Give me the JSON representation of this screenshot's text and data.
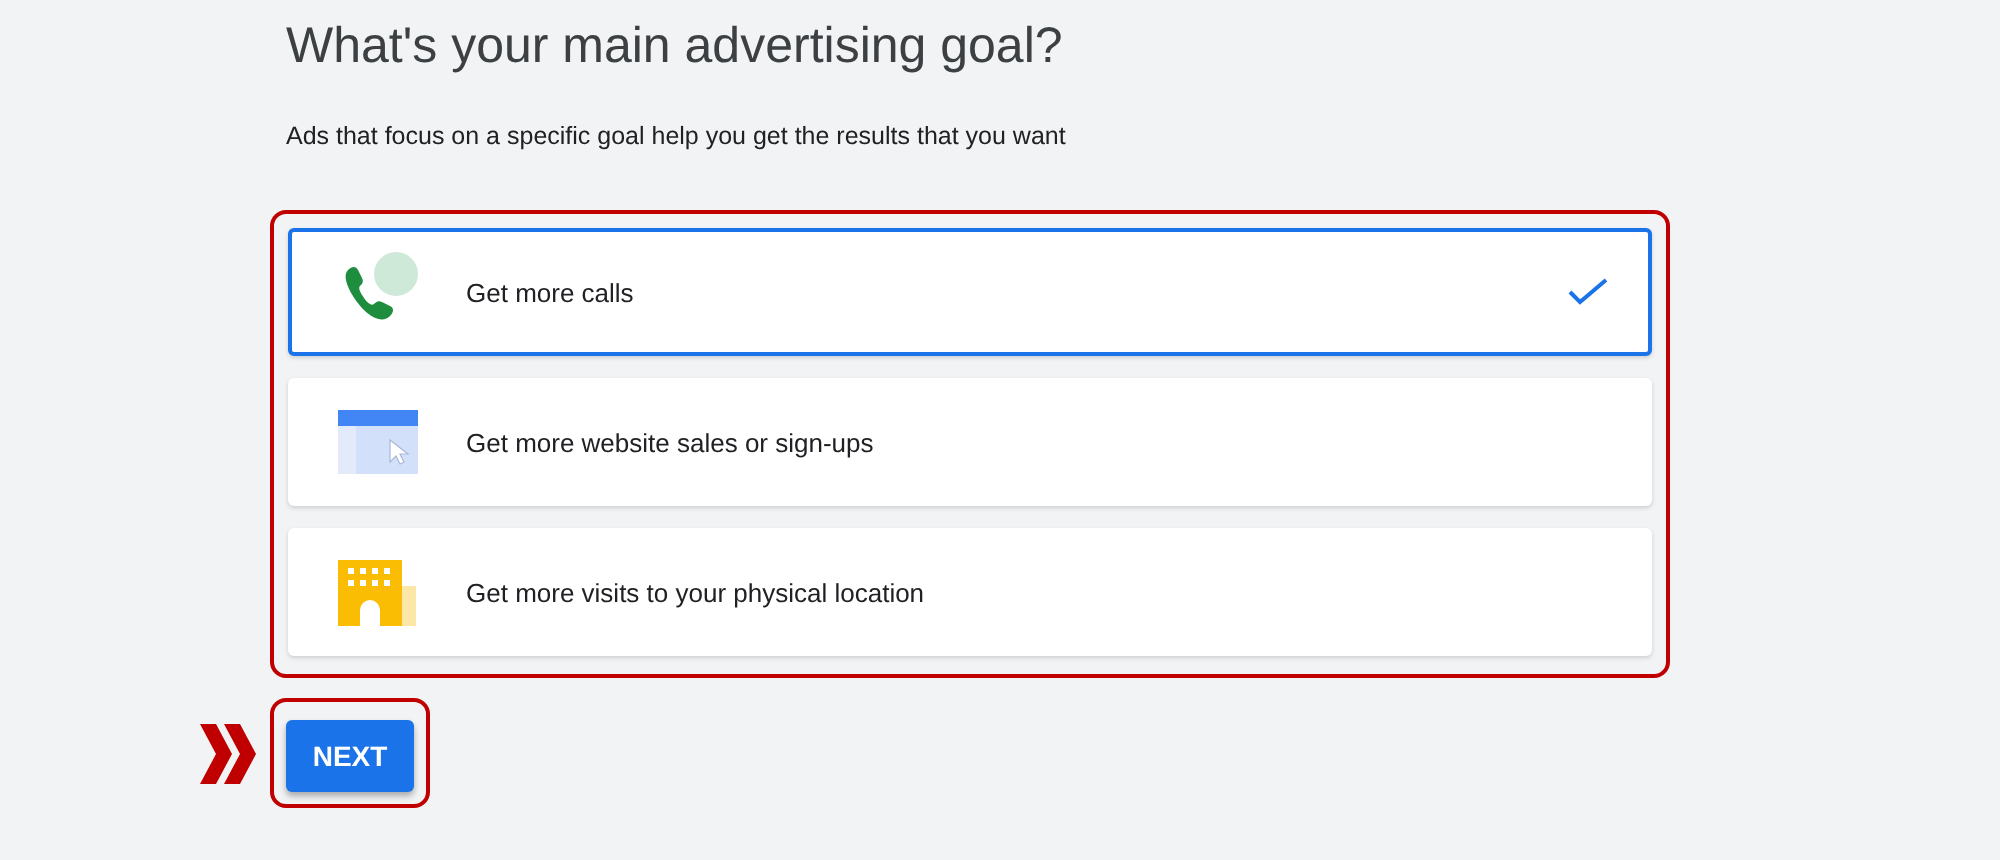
{
  "heading": "What's your main advertising goal?",
  "subtitle": "Ads that focus on a specific goal help you get the results that you want",
  "goals": [
    {
      "kind": "calls",
      "label": "Get more calls",
      "selected": true
    },
    {
      "kind": "website",
      "label": "Get more website sales or sign-ups",
      "selected": false
    },
    {
      "kind": "visits",
      "label": "Get more visits to your physical location",
      "selected": false
    }
  ],
  "next_button": "NEXT"
}
